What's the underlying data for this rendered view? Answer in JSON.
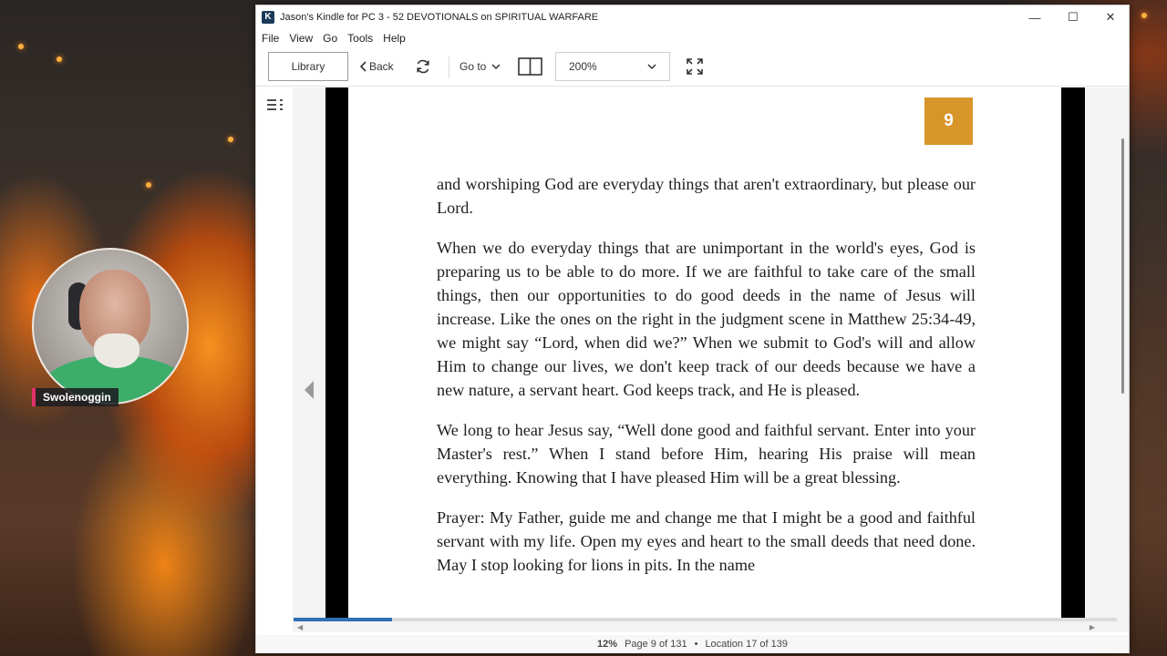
{
  "window": {
    "title": "Jason's Kindle for PC 3 - 52 DEVOTIONALS on SPIRITUAL WARFARE",
    "app_icon_letter": "K",
    "controls": {
      "minimize": "—",
      "maximize": "☐",
      "close": "✕"
    }
  },
  "menu": {
    "file": "File",
    "view": "View",
    "go": "Go",
    "tools": "Tools",
    "help": "Help"
  },
  "toolbar": {
    "library_label": "Library",
    "back_label": "Back",
    "goto_label": "Go to",
    "zoom_value": "200%"
  },
  "page": {
    "badge_number": "9",
    "paragraphs": [
      "and worshiping God are everyday things that aren't extraordinary, but please our Lord.",
      "When we do everyday things that are unimportant in the world's eyes, God is preparing us to be able to do more. If we are faithful to take care of the small things, then our opportunities to do good deeds in the name of Jesus will increase. Like the ones on the right in the judgment scene in Matthew 25:34-49, we might say “Lord, when did we?” When we submit to God's will and allow Him to change our lives, we don't keep track of our deeds because we have a new nature, a servant heart. God keeps track, and He is pleased.",
      "We long to hear Jesus say, “Well done good and faithful servant. Enter into your Master's rest.” When I stand before Him, hearing His praise will mean everything. Knowing that I have pleased Him will be a great blessing.",
      "Prayer: My Father, guide me and change me that I might be a good and faithful servant with my life. Open my eyes and heart to the small deeds that need done. May I stop looking for lions in pits. In the name"
    ]
  },
  "reading_progress": 0.12,
  "status": {
    "percent": "12%",
    "page_info": "Page 9 of 131",
    "separator": "•",
    "location_info": "Location 17 of 139"
  },
  "webcam": {
    "name_label": "Swolenoggin"
  },
  "colors": {
    "accent": "#2f6fb5",
    "badge": "#d7952a",
    "cam_label_bar": "#e0306a"
  },
  "icons": [
    "app-icon",
    "back-chevron-icon",
    "sync-icon",
    "chevron-down-icon",
    "page-layout-icon",
    "fullscreen-icon",
    "table-of-contents-icon",
    "previous-page-arrow-icon"
  ]
}
